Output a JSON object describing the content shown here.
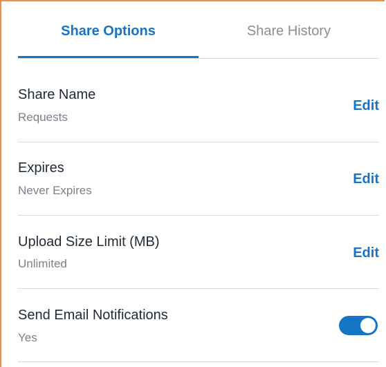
{
  "tabs": {
    "options_label": "Share Options",
    "history_label": "Share History",
    "active": "Share Options"
  },
  "settings": [
    {
      "title": "Share Name",
      "value": "Requests",
      "action": "Edit"
    },
    {
      "title": "Expires",
      "value": "Never Expires",
      "action": "Edit"
    },
    {
      "title": "Upload Size Limit (MB)",
      "value": "Unlimited",
      "action": "Edit"
    },
    {
      "title": "Send Email Notifications",
      "value": "Yes",
      "toggle_on": true
    }
  ],
  "colors": {
    "accent": "#1574c4",
    "frame_border": "#f0903f",
    "divider": "#d9dbe0"
  }
}
